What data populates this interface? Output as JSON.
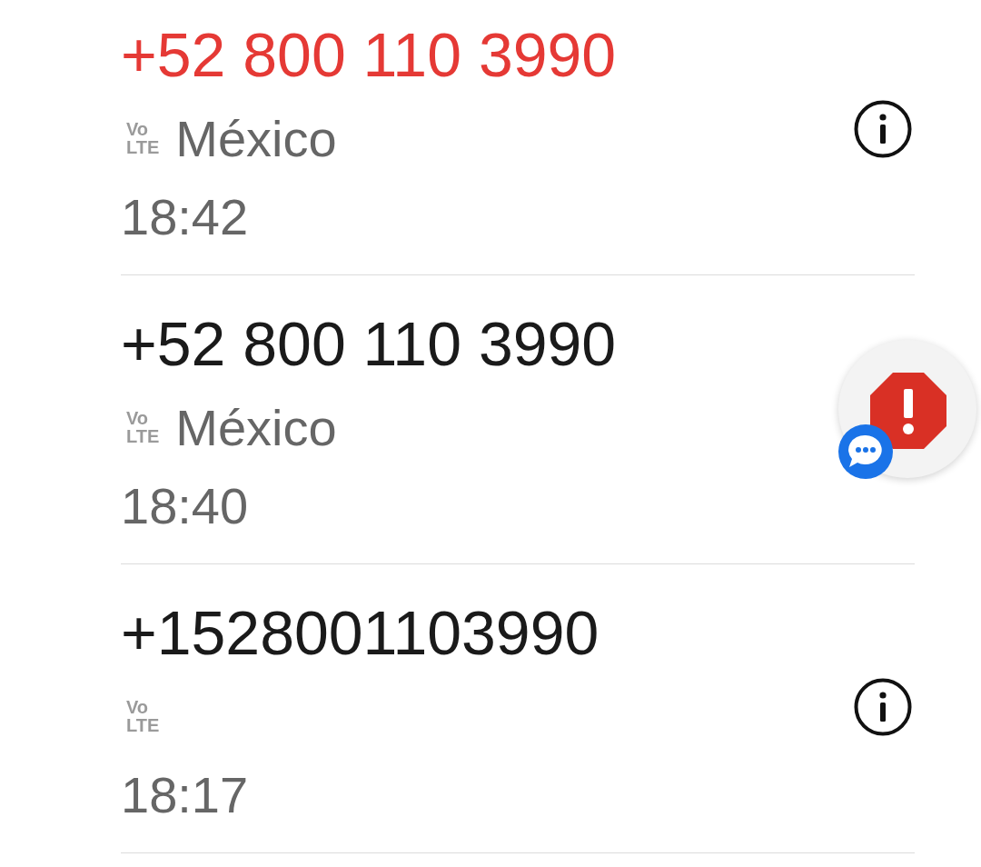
{
  "calls": [
    {
      "number": "+52 800 110 3990",
      "missed": true,
      "network_badge": {
        "top": "Vo",
        "bottom": "LTE"
      },
      "location": "México",
      "time": "18:42",
      "info_button": true
    },
    {
      "number": "+52 800 110 3990",
      "missed": false,
      "network_badge": {
        "top": "Vo",
        "bottom": "LTE"
      },
      "location": "México",
      "time": "18:40"
    },
    {
      "number": "+1528001103990",
      "missed": false,
      "network_badge": {
        "top": "Vo",
        "bottom": "LTE"
      },
      "time": "18:17",
      "info_button": true
    }
  ]
}
